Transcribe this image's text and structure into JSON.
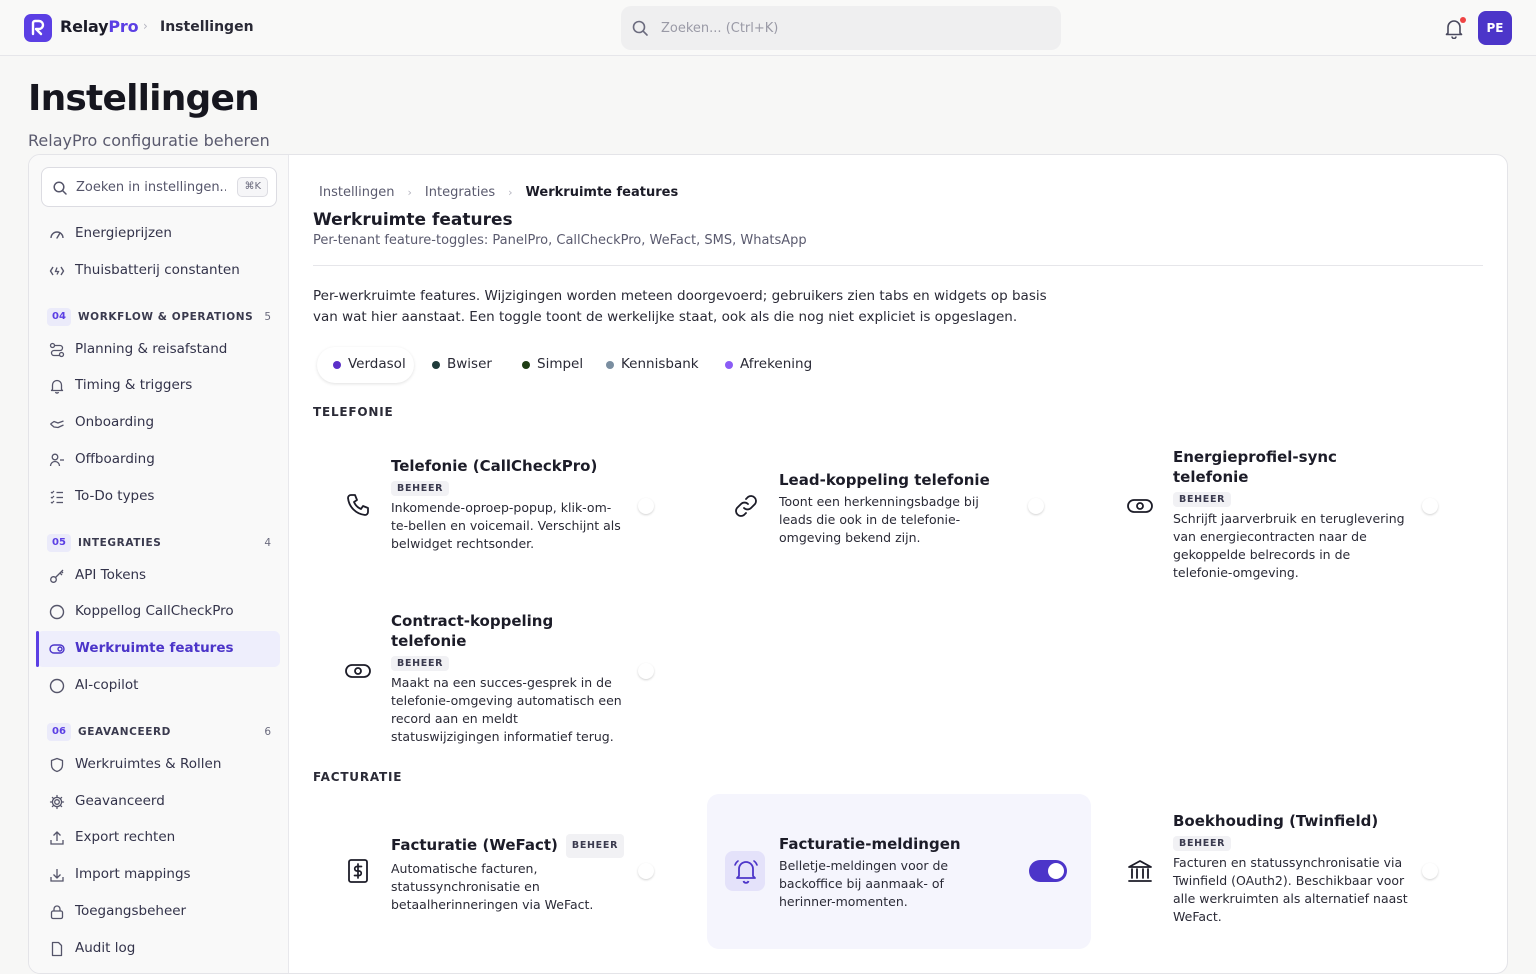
{
  "topbar": {
    "brand_a": "Relay",
    "brand_b": "Pro",
    "title": "Instellingen",
    "search_placeholder": "Zoeken... (Ctrl+K)",
    "avatar": "PE"
  },
  "page": {
    "title": "Instellingen",
    "subtitle": "RelayPro configuratie beheren"
  },
  "sidebar": {
    "search_placeholder": "Zoeken in instellingen...",
    "shortcut": "⌘K",
    "items_top": [
      {
        "label": "Energieprijzen",
        "icon": "gauge-icon"
      },
      {
        "label": "Thuisbatterij constanten",
        "icon": "battery-icon"
      }
    ],
    "groups": [
      {
        "num": "04",
        "label": "WORKFLOW & OPERATIONS",
        "count": "5",
        "items": [
          {
            "label": "Planning & reisafstand",
            "icon": "route-icon"
          },
          {
            "label": "Timing & triggers",
            "icon": "bell-icon"
          },
          {
            "label": "Onboarding",
            "icon": "hand-icon"
          },
          {
            "label": "Offboarding",
            "icon": "user-minus-icon"
          },
          {
            "label": "To-Do types",
            "icon": "list-icon"
          }
        ]
      },
      {
        "num": "05",
        "label": "INTEGRATIES",
        "count": "4",
        "items": [
          {
            "label": "API Tokens",
            "icon": "key-icon"
          },
          {
            "label": "Koppellog CallCheckPro",
            "icon": "circle-icon"
          },
          {
            "label": "Werkruimte features",
            "icon": "toggle-icon",
            "active": true
          },
          {
            "label": "AI-copilot",
            "icon": "circle-icon"
          }
        ]
      },
      {
        "num": "06",
        "label": "GEAVANCEERD",
        "count": "6",
        "items": [
          {
            "label": "Werkruimtes & Rollen",
            "icon": "shield-icon"
          },
          {
            "label": "Geavanceerd",
            "icon": "gear-icon"
          },
          {
            "label": "Export rechten",
            "icon": "upload-icon"
          },
          {
            "label": "Import mappings",
            "icon": "download-icon"
          },
          {
            "label": "Toegangsbeheer",
            "icon": "lock-icon"
          },
          {
            "label": "Audit log",
            "icon": "file-icon"
          }
        ]
      }
    ]
  },
  "main": {
    "breadcrumb": [
      "Instellingen",
      "Integraties",
      "Werkruimte features"
    ],
    "title": "Werkruimte features",
    "subtitle": "Per-tenant feature-toggles: PanelPro, CallCheckPro, WeFact, SMS, WhatsApp",
    "intro": "Per-werkruimte features. Wijzigingen worden meteen doorgevoerd; gebruikers zien tabs en widgets op basis van wat hier aanstaat. Een toggle toont de werkelijke staat, ook als die nog niet expliciet is opgeslagen.",
    "workspaces": [
      {
        "label": "Verdasol",
        "color": "#5b2fc9",
        "active": true
      },
      {
        "label": "Bwiser",
        "color": "#1f3b3a"
      },
      {
        "label": "Simpel",
        "color": "#1e3d14"
      },
      {
        "label": "Kennisbank",
        "color": "#7a8ea0"
      },
      {
        "label": "Afrekening",
        "color": "#8b5cf6"
      }
    ],
    "categories": {
      "telefonie": "TELEFONIE",
      "facturatie": "FACTURATIE"
    },
    "features": {
      "callcheck": {
        "title": "Telefonie (CallCheckPro)",
        "badge": "BEHEER",
        "desc": "Inkomende-oproep-popup, klik-om-te-bellen en voicemail. Verschijnt als belwidget rechtsonder.",
        "enabled": false,
        "icon": "phone-icon"
      },
      "lead": {
        "title": "Lead-koppeling telefonie",
        "desc": "Toont een herkenningsbadge bij leads die ook in de telefonie-omgeving bekend zijn.",
        "enabled": false,
        "icon": "link-icon"
      },
      "energy": {
        "title": "Energieprofiel-sync telefonie",
        "badge": "BEHEER",
        "desc": "Schrijft jaarverbruik en teruglevering van energiecontracten naar de gekoppelde belrecords in de telefonie-omgeving.",
        "enabled": false,
        "icon": "eye-toggle-icon"
      },
      "contract": {
        "title": "Contract-koppeling telefonie",
        "badge": "BEHEER",
        "desc": "Maakt na een succes-gesprek in de telefonie-omgeving automatisch een record aan en meldt statuswijzigingen informatief terug.",
        "enabled": false,
        "icon": "eye-toggle-icon"
      },
      "wefact": {
        "title": "Facturatie (WeFact)",
        "badge": "BEHEER",
        "desc": "Automatische facturen, statussynchronisatie en betaalherinneringen via WeFact.",
        "enabled": false,
        "icon": "dollar-icon"
      },
      "notify": {
        "title": "Facturatie-meldingen",
        "desc": "Belletje-meldingen voor de backoffice bij aanmaak- of herinner-momenten.",
        "enabled": true,
        "icon": "bell-ring-icon"
      },
      "twinfield": {
        "title": "Boekhouding (Twinfield)",
        "badge": "BEHEER",
        "desc": "Facturen en statussynchronisatie via Twinfield (OAuth2). Beschikbaar voor alle werkruimten als alternatief naast WeFact.",
        "enabled": false,
        "icon": "bank-icon"
      }
    }
  },
  "colors": {
    "accent": "#5b3fe4",
    "accent_dark": "#4c35c9",
    "active_bg": "#eeeefc"
  }
}
